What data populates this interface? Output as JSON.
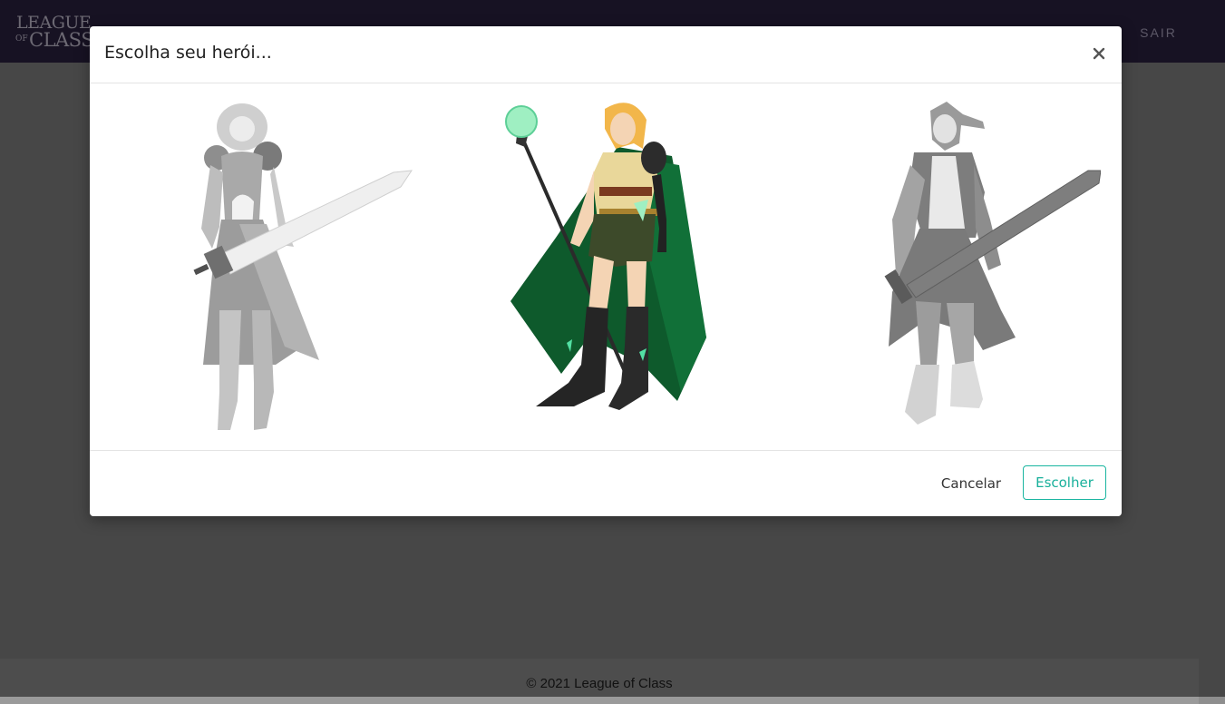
{
  "navbar": {
    "logo_line1": "LEAGUE",
    "logo_line2": "OF",
    "logo_line3": "CLASS",
    "exit_label": "SAIR"
  },
  "footer": {
    "copyright": "© 2021 League of Class"
  },
  "modal": {
    "title": "Escolha seu herói...",
    "close_symbol": "×",
    "heroes": [
      {
        "id": "knight",
        "selected": false
      },
      {
        "id": "mage",
        "selected": true
      },
      {
        "id": "warrior",
        "selected": false
      }
    ],
    "cancel_label": "Cancelar",
    "choose_label": "Escolher"
  },
  "colors": {
    "navbar": "#2f2447",
    "accent": "#18b09b",
    "mage_cape": "#0e5a2c",
    "mage_hair": "#f2b64a",
    "mage_orb": "#9fefc2"
  }
}
